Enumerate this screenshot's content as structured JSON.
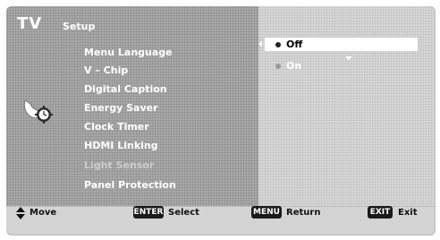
{
  "header": {
    "title": "TV",
    "subtitle": "Setup"
  },
  "menu": {
    "category_icon": "clock-gear-icon",
    "items": [
      {
        "label": "Menu Language",
        "state": "selected"
      },
      {
        "label": "V – Chip",
        "state": "normal"
      },
      {
        "label": "Digital Caption",
        "state": "normal"
      },
      {
        "label": "Energy Saver",
        "state": "normal"
      },
      {
        "label": "Clock Timer",
        "state": "normal"
      },
      {
        "label": "HDMI Linking",
        "state": "normal"
      },
      {
        "label": "Light Sensor",
        "state": "disabled"
      },
      {
        "label": "Panel Protection",
        "state": "normal"
      }
    ]
  },
  "options": {
    "items": [
      {
        "label": "Off",
        "selected": true
      },
      {
        "label": "On",
        "selected": false
      }
    ]
  },
  "footer": {
    "move_label": "Move",
    "enter_key": "ENTER",
    "enter_label": "Select",
    "menu_key": "MENU",
    "menu_label": "Return",
    "exit_key": "EXIT",
    "exit_label": "Exit"
  },
  "colors": {
    "selected_bullet": "#222222",
    "unselected_bullet": "#9a9a9a",
    "on_text": "#ffffff",
    "off_text": "#000000"
  }
}
